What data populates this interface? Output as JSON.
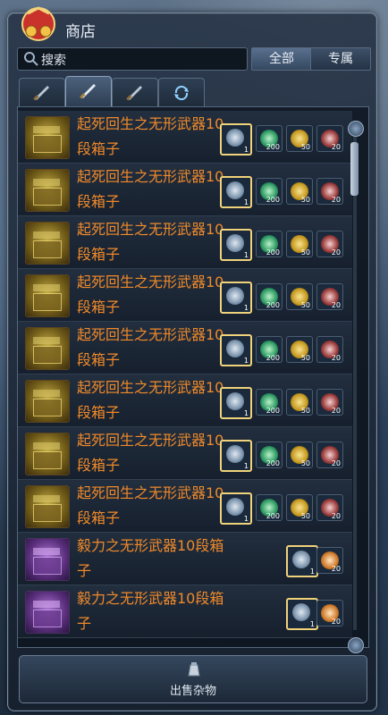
{
  "window": {
    "title": "商店"
  },
  "search": {
    "placeholder": "搜索"
  },
  "filters": [
    {
      "label": "全部",
      "active": true
    },
    {
      "label": "专属",
      "active": false
    }
  ],
  "tabs": [
    {
      "icon": "sword-icon",
      "active": false
    },
    {
      "icon": "sword-icon",
      "active": true
    },
    {
      "icon": "sword-icon",
      "active": false
    },
    {
      "icon": "refresh-icon",
      "active": false
    }
  ],
  "items": [
    {
      "name": "起死回生之无形武器10段箱子",
      "box": "gold",
      "costs": [
        {
          "icon": "weapon-icon",
          "qty": "1"
        },
        {
          "icon": "green-crystal-icon",
          "qty": "200"
        },
        {
          "icon": "gold-ore-icon",
          "qty": "50"
        },
        {
          "icon": "red-relic-icon",
          "qty": "20"
        }
      ]
    },
    {
      "name": "起死回生之无形武器10段箱子",
      "box": "gold",
      "costs": [
        {
          "icon": "weapon-icon",
          "qty": "1"
        },
        {
          "icon": "green-crystal-icon",
          "qty": "200"
        },
        {
          "icon": "gold-ore-icon",
          "qty": "50"
        },
        {
          "icon": "red-relic-icon",
          "qty": "20"
        }
      ]
    },
    {
      "name": "起死回生之无形武器10段箱子",
      "box": "gold",
      "costs": [
        {
          "icon": "weapon-icon",
          "qty": "1"
        },
        {
          "icon": "green-crystal-icon",
          "qty": "200"
        },
        {
          "icon": "gold-ore-icon",
          "qty": "50"
        },
        {
          "icon": "red-relic-icon",
          "qty": "20"
        }
      ]
    },
    {
      "name": "起死回生之无形武器10段箱子",
      "box": "gold",
      "costs": [
        {
          "icon": "weapon-icon",
          "qty": "1"
        },
        {
          "icon": "green-crystal-icon",
          "qty": "200"
        },
        {
          "icon": "gold-ore-icon",
          "qty": "50"
        },
        {
          "icon": "red-relic-icon",
          "qty": "20"
        }
      ]
    },
    {
      "name": "起死回生之无形武器10段箱子",
      "box": "gold",
      "costs": [
        {
          "icon": "weapon-icon",
          "qty": "1"
        },
        {
          "icon": "green-crystal-icon",
          "qty": "200"
        },
        {
          "icon": "gold-ore-icon",
          "qty": "50"
        },
        {
          "icon": "red-relic-icon",
          "qty": "20"
        }
      ]
    },
    {
      "name": "起死回生之无形武器10段箱子",
      "box": "gold",
      "costs": [
        {
          "icon": "weapon-icon",
          "qty": "1"
        },
        {
          "icon": "green-crystal-icon",
          "qty": "200"
        },
        {
          "icon": "gold-ore-icon",
          "qty": "50"
        },
        {
          "icon": "red-relic-icon",
          "qty": "20"
        }
      ]
    },
    {
      "name": "起死回生之无形武器10段箱子",
      "box": "gold",
      "costs": [
        {
          "icon": "weapon-icon",
          "qty": "1"
        },
        {
          "icon": "green-crystal-icon",
          "qty": "200"
        },
        {
          "icon": "gold-ore-icon",
          "qty": "50"
        },
        {
          "icon": "red-relic-icon",
          "qty": "20"
        }
      ]
    },
    {
      "name": "起死回生之无形武器10段箱子",
      "box": "gold",
      "costs": [
        {
          "icon": "weapon-icon",
          "qty": "1"
        },
        {
          "icon": "green-crystal-icon",
          "qty": "200"
        },
        {
          "icon": "gold-ore-icon",
          "qty": "50"
        },
        {
          "icon": "red-relic-icon",
          "qty": "20"
        }
      ]
    },
    {
      "name": "毅力之无形武器10段箱子",
      "box": "purple",
      "costs": [
        {
          "icon": "weapon-icon",
          "qty": "1"
        },
        {
          "icon": "potion-icon",
          "qty": "20"
        }
      ]
    },
    {
      "name": "毅力之无形武器10段箱子",
      "box": "purple",
      "costs": [
        {
          "icon": "weapon-icon",
          "qty": "1"
        },
        {
          "icon": "potion-icon",
          "qty": "20"
        }
      ]
    }
  ],
  "footer": {
    "sell_label": "出售杂物"
  }
}
